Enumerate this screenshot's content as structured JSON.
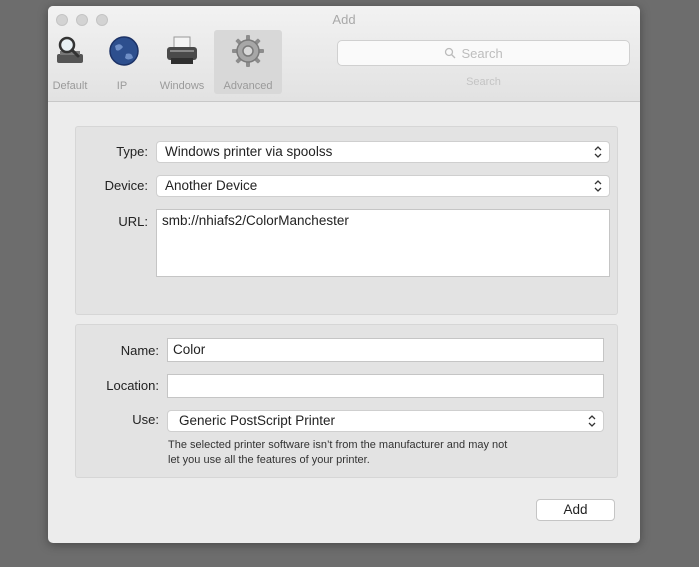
{
  "window": {
    "title": "Add"
  },
  "toolbar": {
    "tabs": [
      {
        "label": "Default",
        "icon": "magnifier-printer-icon"
      },
      {
        "label": "IP",
        "icon": "globe-icon"
      },
      {
        "label": "Windows",
        "icon": "printer-icon"
      },
      {
        "label": "Advanced",
        "icon": "gear-icon",
        "selected": true
      }
    ],
    "search": {
      "placeholder": "Search",
      "caption": "Search"
    }
  },
  "connection": {
    "type_label": "Type:",
    "type_value": "Windows printer via spoolss",
    "device_label": "Device:",
    "device_value": "Another Device",
    "url_label": "URL:",
    "url_value": "smb://nhiafs2/ColorManchester"
  },
  "printer": {
    "name_label": "Name:",
    "name_value": "Color",
    "location_label": "Location:",
    "location_value": "",
    "use_label": "Use:",
    "use_value": "Generic PostScript Printer",
    "note_line1": "The selected printer software isn’t from the manufacturer and may not",
    "note_line2": "let you use all the features of your printer."
  },
  "footer": {
    "add_label": "Add"
  }
}
